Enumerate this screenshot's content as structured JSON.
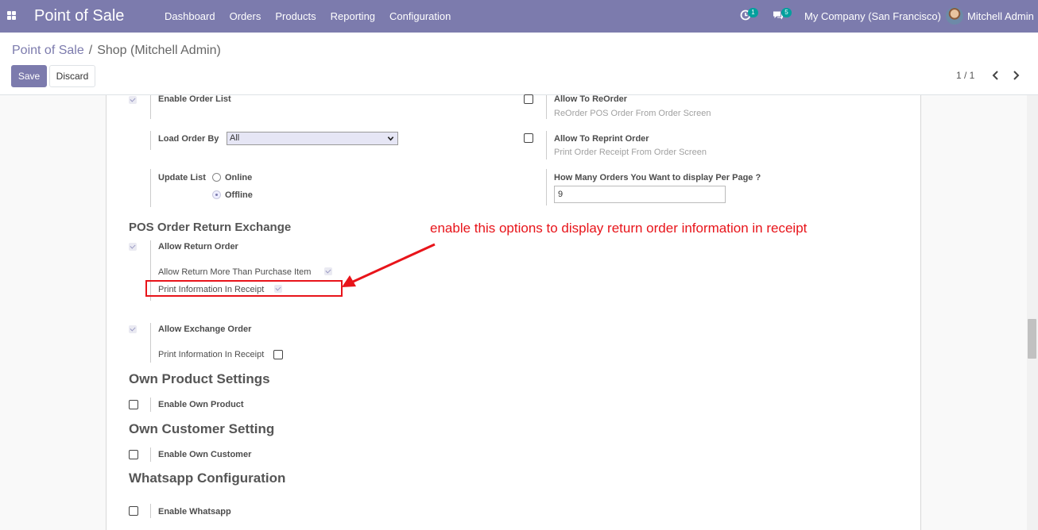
{
  "navbar": {
    "app_title": "Point of Sale",
    "menu": [
      "Dashboard",
      "Orders",
      "Products",
      "Reporting",
      "Configuration"
    ],
    "activity_count": "1",
    "message_count": "5",
    "company": "My Company (San Francisco)",
    "user": "Mitchell Admin"
  },
  "control_panel": {
    "breadcrumb_parent": "Point of Sale",
    "breadcrumb_separator": "/",
    "breadcrumb_current": "Shop (Mitchell Admin)",
    "save_label": "Save",
    "discard_label": "Discard",
    "pager": "1 / 1"
  },
  "form": {
    "enable_order_list": {
      "label": "Enable Order List",
      "checked": true
    },
    "load_order_by": {
      "label": "Load Order By",
      "value": "All"
    },
    "update_list": {
      "label": "Update List",
      "options": [
        "Online",
        "Offline"
      ],
      "selected": "Offline"
    },
    "allow_reorder": {
      "label": "Allow To ReOrder",
      "help": "ReOrder POS Order From Order Screen",
      "checked": false
    },
    "allow_reprint": {
      "label": "Allow To Reprint Order",
      "help": "Print Order Receipt From Order Screen",
      "checked": false
    },
    "orders_per_page": {
      "label": "How Many Orders You Want to display Per Page ?",
      "value": "9"
    },
    "section_return_exchange": "POS Order Return Exchange",
    "allow_return_order": {
      "label": "Allow Return Order",
      "checked": true
    },
    "allow_return_more": {
      "label": "Allow Return More Than Purchase Item",
      "checked": true
    },
    "return_print_info": {
      "label": "Print Information In Receipt",
      "checked": true
    },
    "allow_exchange_order": {
      "label": "Allow Exchange Order",
      "checked": true
    },
    "exchange_print_info": {
      "label": "Print Information In Receipt",
      "checked": false
    },
    "section_own_product": "Own Product Settings",
    "enable_own_product": {
      "label": "Enable Own Product",
      "checked": false
    },
    "section_own_customer": "Own Customer Setting",
    "enable_own_customer": {
      "label": "Enable Own Customer",
      "checked": false
    },
    "section_whatsapp": "Whatsapp Configuration",
    "enable_whatsapp": {
      "label": "Enable Whatsapp",
      "checked": false
    }
  },
  "annotation": {
    "text": "enable this options to display return order information in receipt",
    "color": "#e8141a"
  },
  "colors": {
    "brand": "#7c7bad",
    "badge": "#00a09d"
  }
}
